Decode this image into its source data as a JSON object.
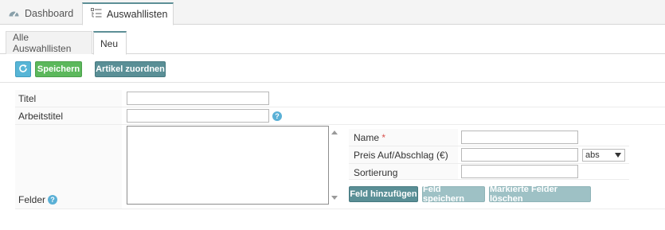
{
  "top_tabs": [
    {
      "label": "Dashboard",
      "icon": "dashboard-icon"
    },
    {
      "label": "Auswahllisten",
      "icon": "list-icon"
    }
  ],
  "sub_tabs": [
    {
      "label": "Alle Auswahllisten"
    },
    {
      "label": "Neu"
    }
  ],
  "toolbar": {
    "refresh_icon": "refresh-icon",
    "save_label": "Speichern",
    "assign_label": "Artikel zuordnen"
  },
  "form": {
    "title_label": "Titel",
    "title_value": "",
    "worktitle_label": "Arbeitstitel",
    "worktitle_value": "",
    "fields_label": "Felder",
    "fields_value": "",
    "help_glyph": "?"
  },
  "fields_editor": {
    "name_label": "Name",
    "required_mark": "*",
    "name_value": "",
    "price_label": "Preis Auf/Abschlag (€)",
    "price_value": "",
    "price_mode": "abs",
    "sort_label": "Sortierung",
    "sort_value": "",
    "add_label": "Feld hinzufügen",
    "save_field_label": "Feld speichern",
    "delete_label": "Markierte Felder löschen"
  },
  "colors": {
    "accent": "#5a8f96",
    "save_green": "#5cb85c",
    "help_blue": "#5ab0d6",
    "required_red": "#d9534f"
  }
}
